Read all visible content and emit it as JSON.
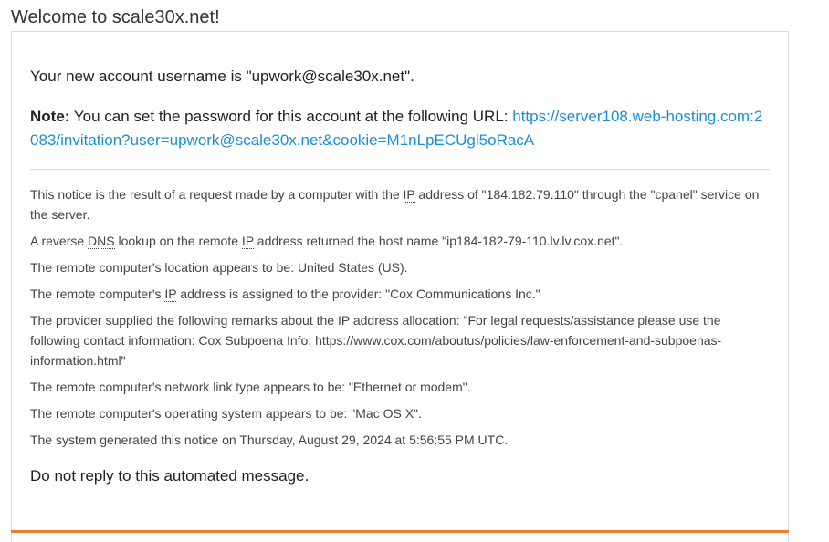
{
  "heading": "Welcome to scale30x.net!",
  "message": {
    "username_line": "Your new account username is \"upwork@scale30x.net\".",
    "note_label": "Note:",
    "note_text": " You can set the password for this account at the following URL: ",
    "note_url": "https://server108.web-hosting.com:2083/invitation?user=upwork@scale30x.net&cookie=M1nLpECUgl5oRacA"
  },
  "notice": {
    "line1_pre": "This notice is the result of a request made by a computer with the ",
    "abbr_ip": "IP",
    "abbr_dns": "DNS",
    "line1_post": " address of \"184.182.79.110\" through the \"cpanel\" service on the server.",
    "line2_pre": "A reverse ",
    "line2_mid": " lookup on the remote ",
    "line2_post": " address returned the host name \"ip184-182-79-110.lv.lv.cox.net\".",
    "line3": "The remote computer's location appears to be: United States (US).",
    "line4_pre": "The remote computer's ",
    "line4_post": " address is assigned to the provider: \"Cox Communications Inc.\"",
    "line5_pre": "The provider supplied the following remarks about the ",
    "line5_post": " address allocation: \"For legal requests/assistance please use the following contact information: Cox Subpoena Info: https://www.cox.com/aboutus/policies/law-enforcement-and-subpoenas-information.html\"",
    "line6": "The remote computer's network link type appears to be: \"Ethernet or modem\".",
    "line7": "The remote computer's operating system appears to be: \"Mac OS X\".",
    "line8": "The system generated this notice on Thursday, August 29, 2024 at 5:56:55 PM UTC."
  },
  "closing": "Do not reply to this automated message.",
  "colors": {
    "link": "#1a8fd6",
    "accent_bar": "#f07c2e",
    "text": "#333333"
  }
}
